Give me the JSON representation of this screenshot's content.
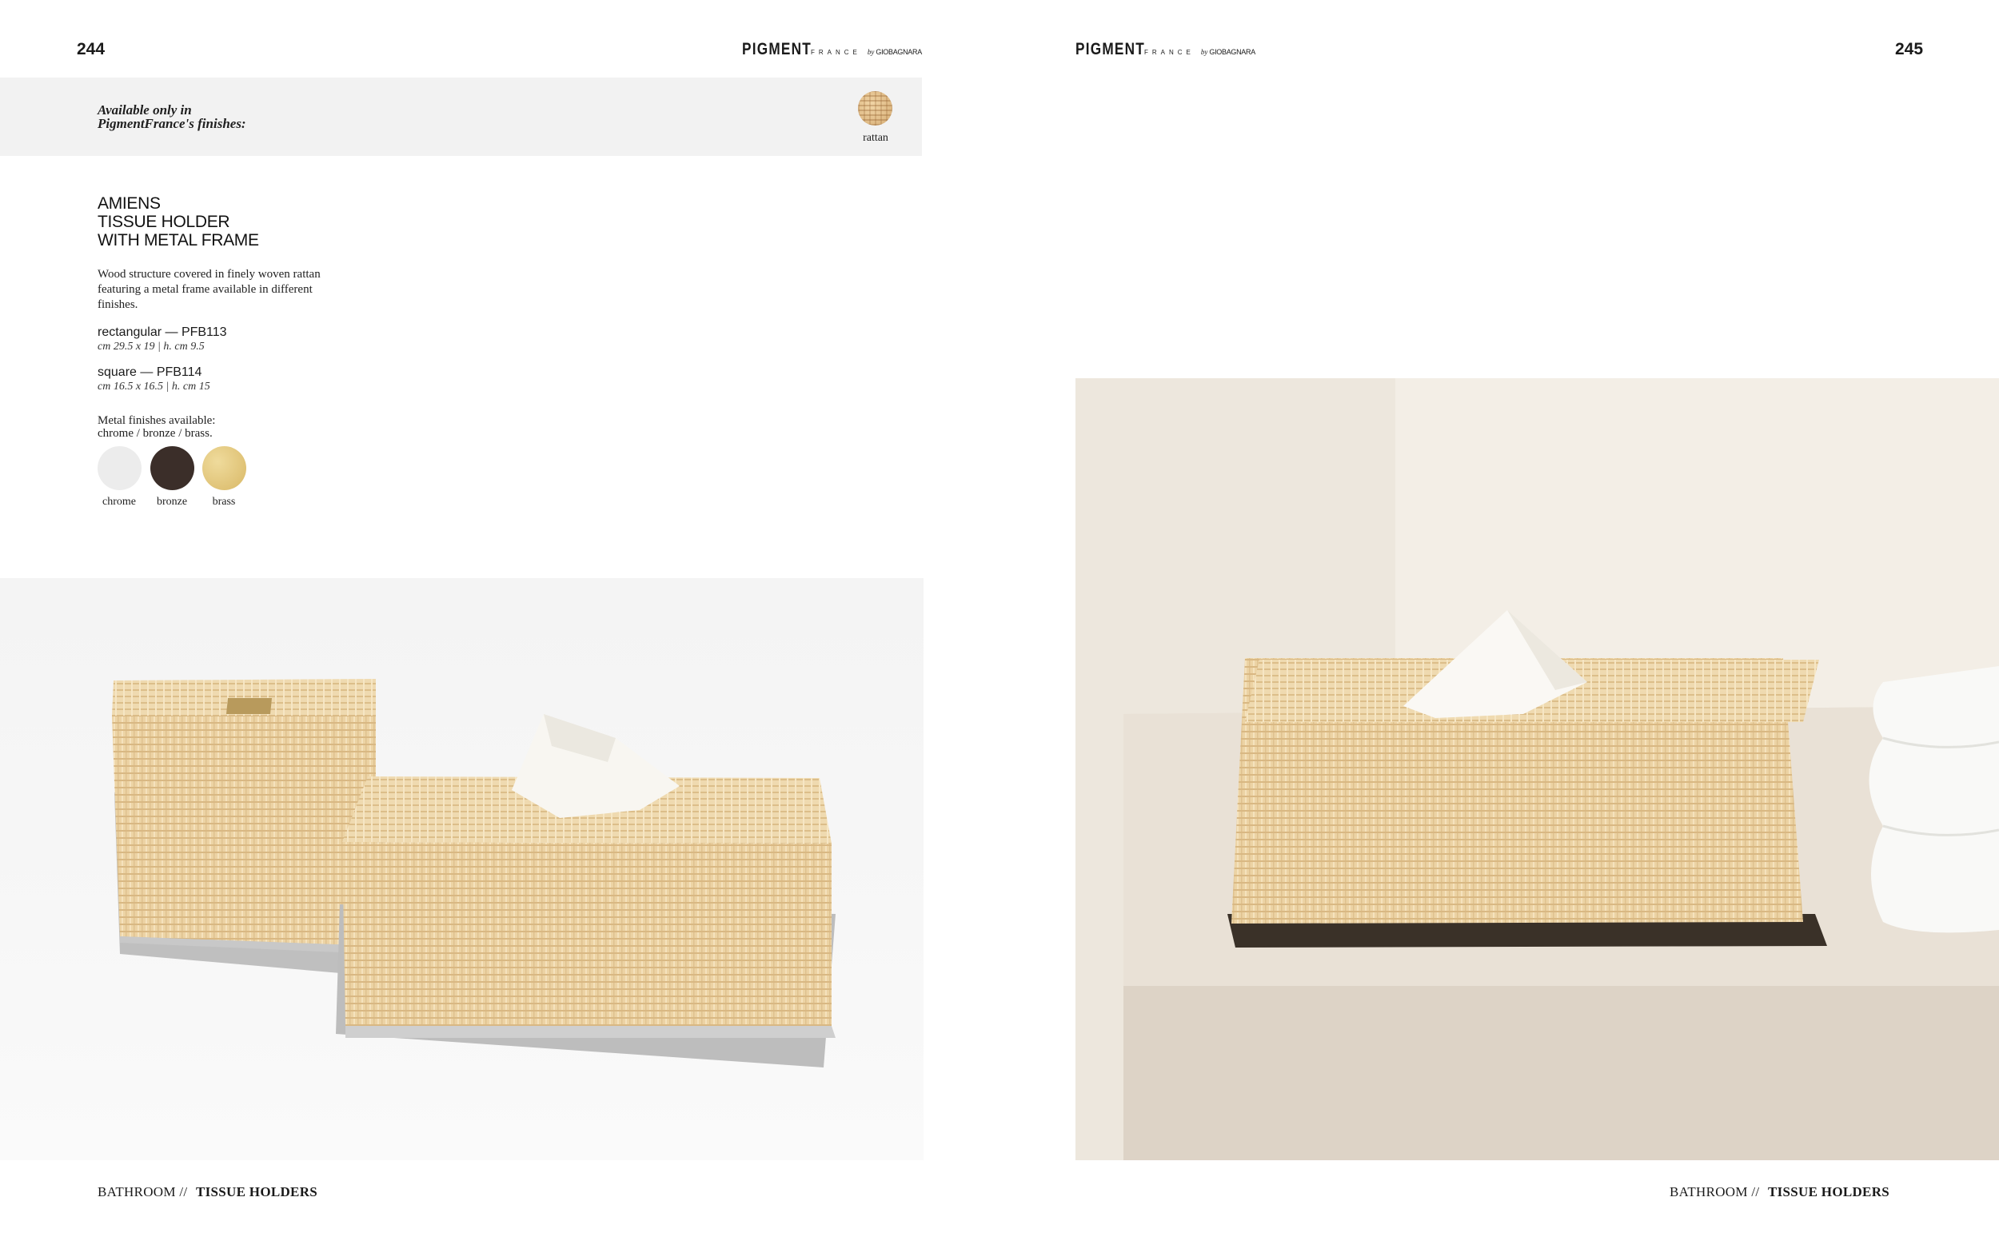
{
  "left_page": {
    "page_number": "244",
    "brand": {
      "name": "PIGMENT",
      "sub": "FRANCE",
      "by": "by",
      "maker": "GIOBAGNARA"
    },
    "finishes_band": {
      "label_line1": "Available only in",
      "label_line2": "PigmentFrance's finishes:",
      "finish_label": "rattan"
    },
    "product": {
      "title_lines": [
        "AMIENS",
        "TISSUE HOLDER",
        "WITH METAL FRAME"
      ],
      "description": "Wood structure covered in finely woven rattan featuring a metal frame available in different finishes.",
      "variants": [
        {
          "name": "rectangular — PFB113",
          "dimensions": "cm 29.5 x 19 | h. cm 9.5"
        },
        {
          "name": "square — PFB114",
          "dimensions": "cm 16.5 x 16.5 | h. cm 15"
        }
      ],
      "metal_label_line1": "Metal finishes available:",
      "metal_label_line2": "chrome / bronze / brass.",
      "metal_finishes": [
        {
          "label": "chrome",
          "color": "#ececec"
        },
        {
          "label": "bronze",
          "color": "#3b2e29"
        },
        {
          "label": "brass",
          "color": "#e3c77c"
        }
      ]
    },
    "footer": {
      "section": "BATHROOM //",
      "category": "TISSUE HOLDERS"
    }
  },
  "right_page": {
    "page_number": "245",
    "brand": {
      "name": "PIGMENT",
      "sub": "FRANCE",
      "by": "by",
      "maker": "GIOBAGNARA"
    },
    "footer": {
      "section": "BATHROOM //",
      "category": "TISSUE HOLDERS"
    }
  },
  "colors": {
    "rattan": "#e8cfa0",
    "band_background": "#f2f2f2",
    "text": "#1a1a1a"
  }
}
